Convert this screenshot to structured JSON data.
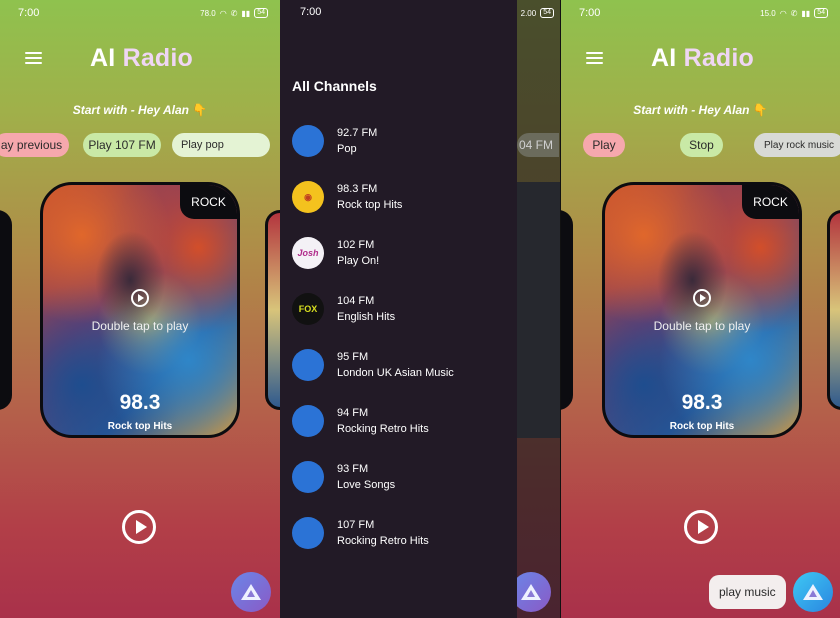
{
  "status": {
    "time": "7:00",
    "net_p1": "78.0",
    "net_p2": "2.00",
    "net_p3": "15.0",
    "net_unit": "KB/S",
    "battery": "54"
  },
  "app": {
    "title_ai": "AI",
    "title_radio": "Radio",
    "hint": "Start with - Hey Alan",
    "hint_emoji": "👇"
  },
  "screen1": {
    "chips": [
      "ay previous",
      "Play 107 FM",
      "Play pop"
    ],
    "card": {
      "tag": "ROCK",
      "double_tap": "Double tap to play",
      "frequency": "98.3",
      "name": "Rock top Hits"
    }
  },
  "screen2": {
    "heading": "All Channels",
    "ghost_chip": "04 FM",
    "channels": [
      {
        "freq": "92.7 FM",
        "name": "Pop",
        "logo": "blue-circle"
      },
      {
        "freq": "98.3 FM",
        "name": "Rock top Hits",
        "logo": "yellow-logo"
      },
      {
        "freq": "102 FM",
        "name": "Play On!",
        "logo": "josh-logo",
        "logo_text": "Josh"
      },
      {
        "freq": "104 FM",
        "name": "English Hits",
        "logo": "fox-logo",
        "logo_text": "FOX"
      },
      {
        "freq": "95 FM",
        "name": "London UK Asian Music",
        "logo": "blue-circle"
      },
      {
        "freq": "94 FM",
        "name": "Rocking Retro Hits",
        "logo": "blue-circle"
      },
      {
        "freq": "93 FM",
        "name": "Love Songs",
        "logo": "blue-circle"
      },
      {
        "freq": "107 FM",
        "name": "Rocking Retro Hits",
        "logo": "blue-circle"
      }
    ]
  },
  "screen3": {
    "chips": [
      "Play",
      "Stop",
      "Play rock music"
    ],
    "card": {
      "tag": "ROCK",
      "double_tap": "Double tap to play",
      "frequency": "98.3",
      "name": "Rock top Hits"
    },
    "bubble": "play music"
  },
  "colors": {
    "accent_blue": "#2b73d6",
    "drawer_bg": "#221a26",
    "gradient_top": "#8fc24e",
    "gradient_bottom": "#a9314a"
  }
}
